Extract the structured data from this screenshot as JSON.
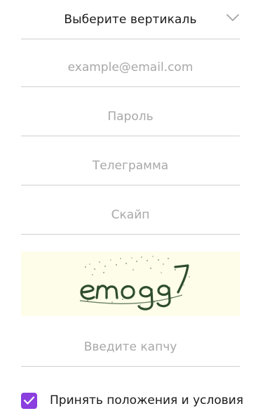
{
  "vertical_select": {
    "value": "Выберите вертикаль",
    "icon": "chevron-down-icon"
  },
  "email": {
    "placeholder": "example@email.com",
    "value": ""
  },
  "password": {
    "placeholder": "Пароль",
    "value": ""
  },
  "telegram": {
    "placeholder": "Телеграмма",
    "value": ""
  },
  "skype": {
    "placeholder": "Скайп",
    "value": ""
  },
  "captcha_input": {
    "placeholder": "Введите капчу",
    "value": ""
  },
  "terms": {
    "checked": true,
    "label": "Принять положения и условия"
  },
  "colors": {
    "accent": "#8a3fde",
    "captcha_background": "#fdfde9",
    "placeholder": "#a8a8a8",
    "divider": "#cfcfcf"
  }
}
